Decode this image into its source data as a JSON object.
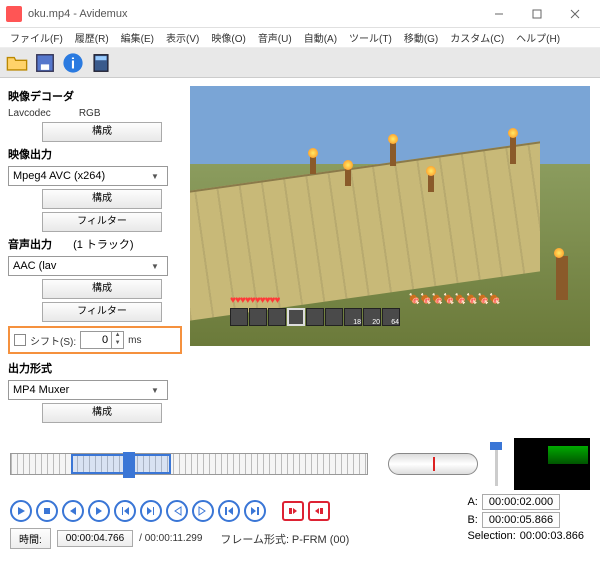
{
  "window": {
    "title": "oku.mp4 - Avidemux"
  },
  "menu": {
    "file": "ファイル(F)",
    "history": "履歴(R)",
    "edit": "編集(E)",
    "view": "表示(V)",
    "video": "映像(O)",
    "audio": "音声(U)",
    "auto": "自動(A)",
    "tools": "ツール(T)",
    "goto": "移動(G)",
    "custom": "カスタム(C)",
    "help": "ヘルプ(H)"
  },
  "left": {
    "decoder_title": "映像デコーダ",
    "decoder_codec": "Lavcodec",
    "decoder_fmt": "RGB",
    "configure": "構成",
    "video_out_title": "映像出力",
    "video_out_sel": "Mpeg4 AVC (x264)",
    "filter": "フィルター",
    "audio_out_title": "音声出力",
    "audio_tracks": "(1 トラック)",
    "audio_out_sel": "AAC (lav",
    "shift_label": "シフト(S):",
    "shift_value": "0",
    "shift_unit": "ms",
    "output_fmt_title": "出力形式",
    "output_fmt_sel": "MP4 Muxer"
  },
  "hotbar": {
    "n1": "18",
    "n2": "20",
    "n3": "64"
  },
  "ab": {
    "a_label": "A:",
    "a_val": "00:00:02.000",
    "b_label": "B:",
    "b_val": "00:00:05.866",
    "sel_label": "Selection:",
    "sel_val": "00:00:03.866"
  },
  "time": {
    "label": "時間:",
    "current": "00:00:04.766",
    "total": "/ 00:00:11.299",
    "frame_label": "フレーム形式:",
    "frame_val": "P-FRM (00)"
  }
}
